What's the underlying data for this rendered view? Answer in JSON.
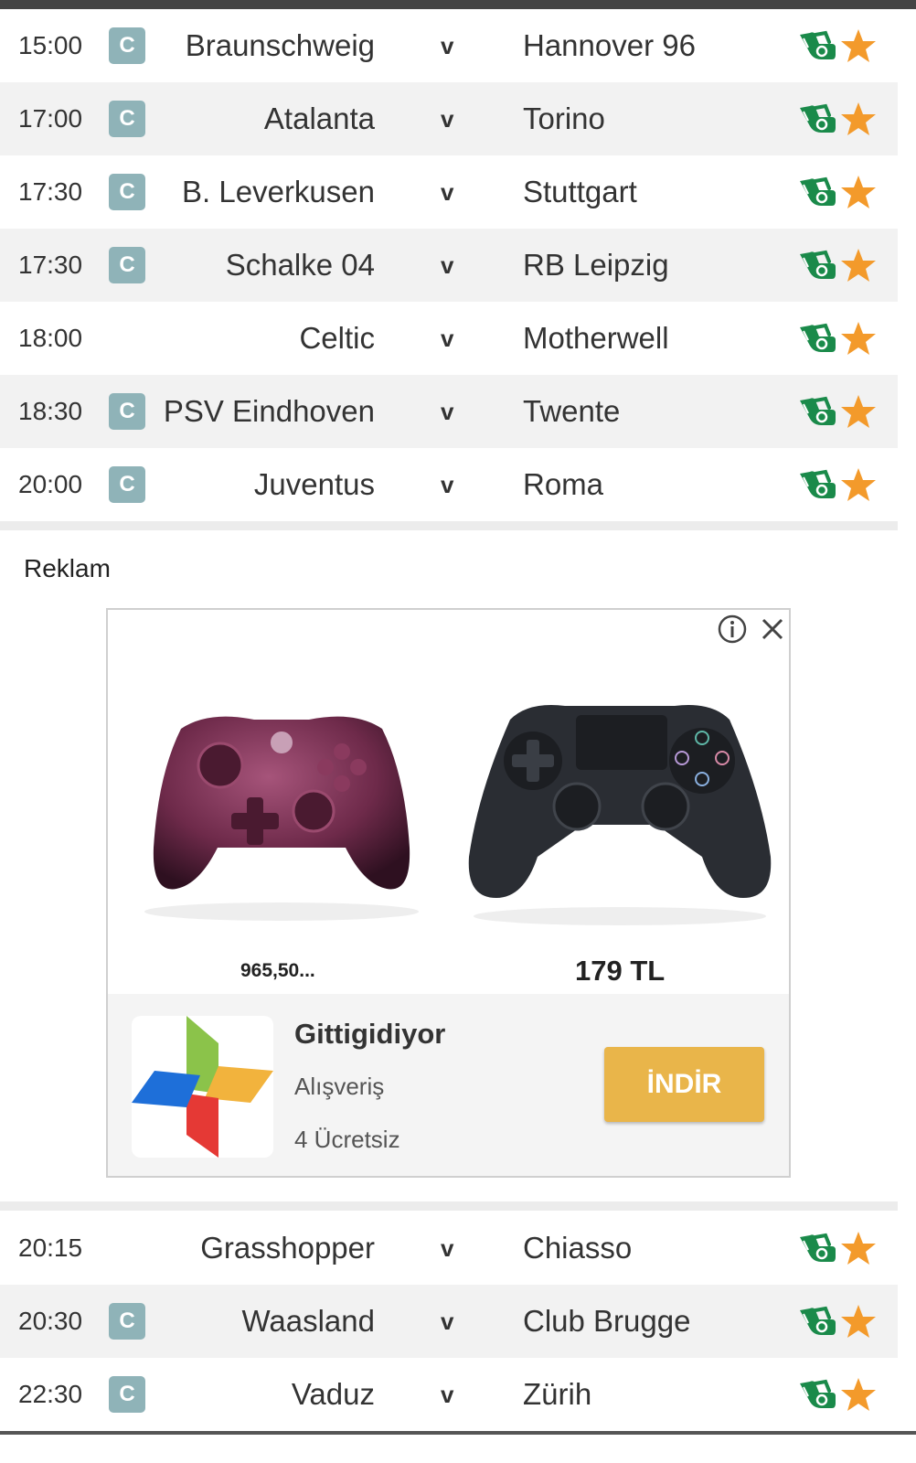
{
  "colors": {
    "badge": "#8fb3b8",
    "bet_icon": "#1a8a4a",
    "star": "#f39a2b",
    "install_button": "#e9b54a",
    "top_bar": "#444444"
  },
  "matches_before_ad": [
    {
      "time": "15:00",
      "badge": "C",
      "home": "Braunschweig",
      "vs": "v",
      "away": "Hannover 96"
    },
    {
      "time": "17:00",
      "badge": "C",
      "home": "Atalanta",
      "vs": "v",
      "away": "Torino"
    },
    {
      "time": "17:30",
      "badge": "C",
      "home": "B. Leverkusen",
      "vs": "v",
      "away": "Stuttgart"
    },
    {
      "time": "17:30",
      "badge": "C",
      "home": "Schalke 04",
      "vs": "v",
      "away": "RB Leipzig"
    },
    {
      "time": "18:00",
      "badge": "",
      "home": "Celtic",
      "vs": "v",
      "away": "Motherwell"
    },
    {
      "time": "18:30",
      "badge": "C",
      "home": "PSV Eindhoven",
      "vs": "v",
      "away": "Twente"
    },
    {
      "time": "20:00",
      "badge": "C",
      "home": "Juventus",
      "vs": "v",
      "away": "Roma"
    }
  ],
  "ad": {
    "label": "Reklam",
    "info_icon": "info-icon",
    "close_icon": "close-icon",
    "product1": {
      "price": "965,50..."
    },
    "product2": {
      "price": "179 TL"
    },
    "app": {
      "name": "Gittigidiyor",
      "category": "Alışveriş",
      "rating": "4  Ücretsiz",
      "install": "İNDİR"
    }
  },
  "matches_after_ad": [
    {
      "time": "20:15",
      "badge": "",
      "home": "Grasshopper",
      "vs": "v",
      "away": "Chiasso"
    },
    {
      "time": "20:30",
      "badge": "C",
      "home": "Waasland",
      "vs": "v",
      "away": "Club Brugge"
    },
    {
      "time": "22:30",
      "badge": "C",
      "home": "Vaduz",
      "vs": "v",
      "away": "Zürih"
    }
  ],
  "icons": {
    "bet": "bet-hand-icon",
    "favorite": "star-icon"
  }
}
